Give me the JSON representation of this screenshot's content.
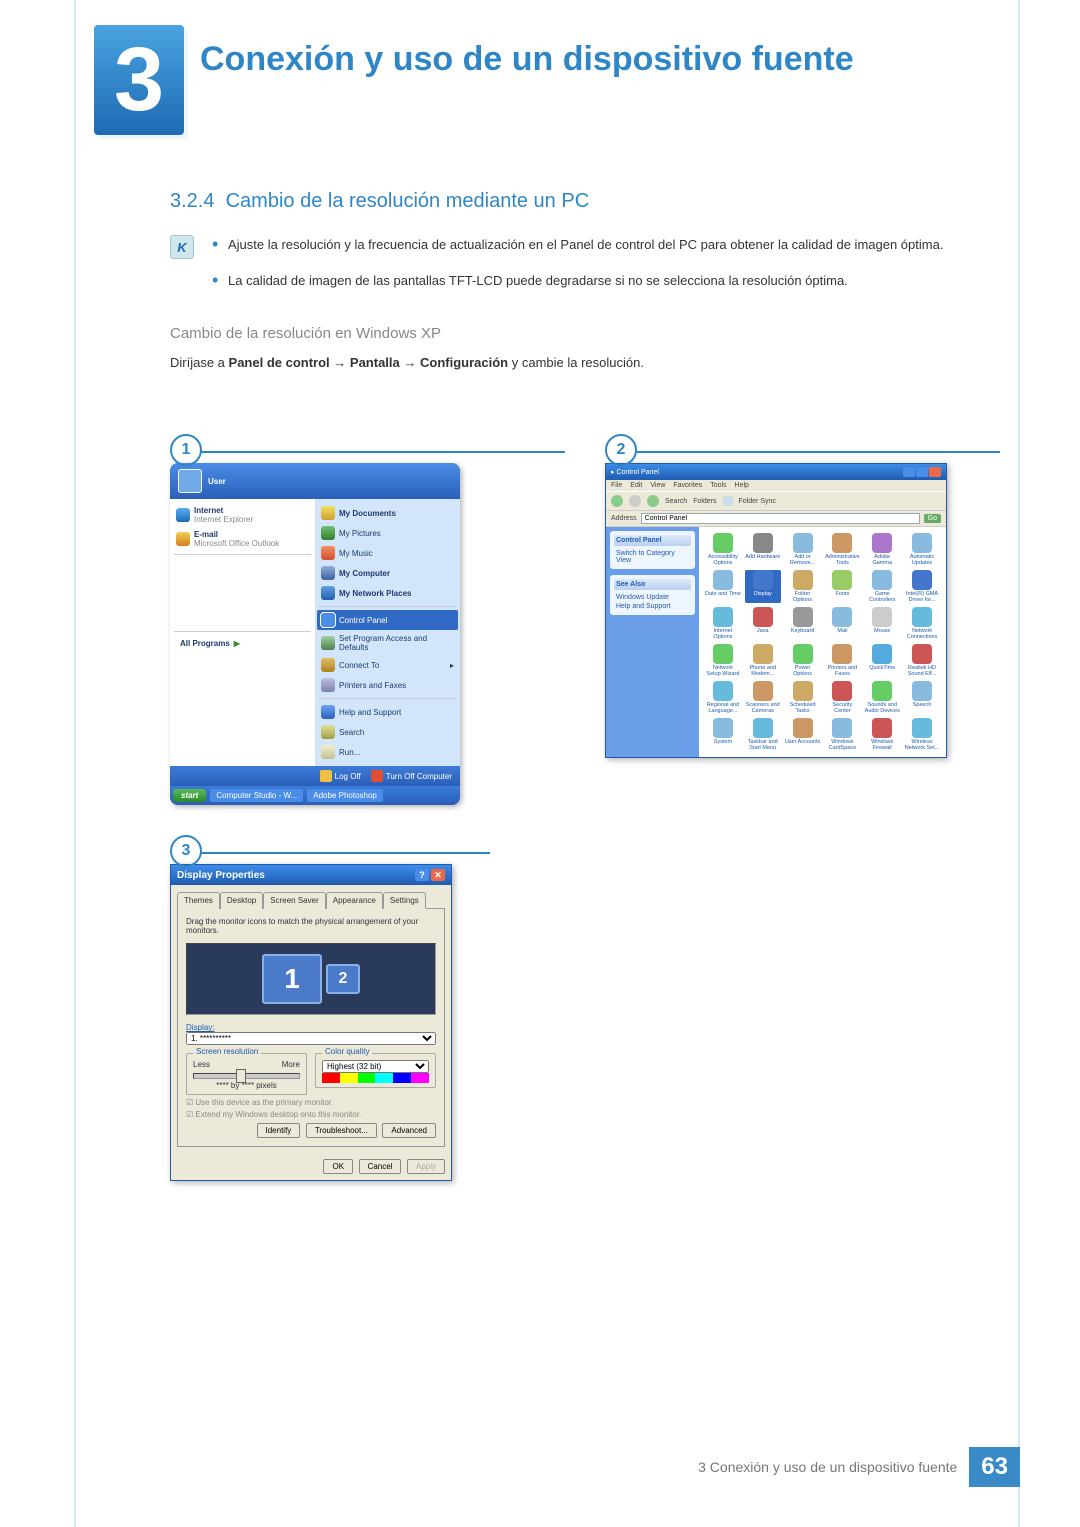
{
  "chapter": {
    "number": "3",
    "title": "Conexión y uso de un dispositivo fuente"
  },
  "section": {
    "number": "3.2.4",
    "title": "Cambio de la resolución mediante un PC"
  },
  "notes": [
    "Ajuste la resolución y la frecuencia de actualización en el Panel de control del PC para obtener la calidad de imagen óptima.",
    "La calidad de imagen de las pantallas TFT-LCD puede degradarse si no se selecciona la resolución óptima."
  ],
  "subheading": "Cambio de la resolución en Windows XP",
  "path": {
    "prefix": "Diríjase a ",
    "a": "Panel de control",
    "b": "Pantalla",
    "c": "Configuración",
    "suffix": " y cambie la resolución.",
    "arrow": " → "
  },
  "fig": {
    "n1": "1",
    "n2": "2",
    "n3": "3"
  },
  "startmenu": {
    "user": "User",
    "left": {
      "internet": "Internet",
      "internet_sub": "Internet Explorer",
      "email": "E-mail",
      "email_sub": "Microsoft Office Outlook",
      "allprograms": "All Programs"
    },
    "right": {
      "mydocs": "My Documents",
      "mypics": "My Pictures",
      "mymusic": "My Music",
      "mycomp": "My Computer",
      "mynet": "My Network Places",
      "cp": "Control Panel",
      "setprog": "Set Program Access and Defaults",
      "connect": "Connect To",
      "printers": "Printers and Faxes",
      "help": "Help and Support",
      "search": "Search",
      "run": "Run..."
    },
    "logoff": "Log Off",
    "turnoff": "Turn Off Computer",
    "taskbar": {
      "start": "start",
      "t1": "Computer Studio - W...",
      "t2": "Adobe Photoshop"
    }
  },
  "controlpanel": {
    "title": "Control Panel",
    "menus": [
      "File",
      "Edit",
      "View",
      "Favorites",
      "Tools",
      "Help"
    ],
    "toolbar": {
      "search": "Search",
      "folders": "Folders",
      "sync": "Folder Sync"
    },
    "address_label": "Address",
    "address_value": "Control Panel",
    "go": "Go",
    "side": {
      "h1": "Control Panel",
      "switch": "Switch to Category View",
      "h2": "See Also",
      "wu": "Windows Update",
      "hs": "Help and Support"
    },
    "icons": [
      "Accessibility Options",
      "Add Hardware",
      "Add or Remove...",
      "Administrative Tools",
      "Adobe Gamma",
      "Automatic Updates",
      "Date and Time",
      "Display",
      "Folder Options",
      "Fonts",
      "Game Controllers",
      "Intel(R) GMA Driver for...",
      "Internet Options",
      "Java",
      "Keyboard",
      "Mail",
      "Mouse",
      "Network Connections",
      "Network Setup Wizard",
      "Phone and Modem...",
      "Power Options",
      "Printers and Faxes",
      "QuickTime",
      "Realtek HD Sound Eff...",
      "Regional and Language...",
      "Scanners and Cameras",
      "Scheduled Tasks",
      "Security Center",
      "Sounds and Audio Devices",
      "Speech",
      "System",
      "Taskbar and Start Menu",
      "User Accounts",
      "Windows CardSpace",
      "Windows Firewall",
      "Wireless Network Set..."
    ],
    "icon_colors": [
      "#6c6",
      "#888",
      "#8bd",
      "#c96",
      "#a7c",
      "#8bd",
      "#8bd",
      "#47c",
      "#ca6",
      "#9c6",
      "#8bd",
      "#47c",
      "#6bd",
      "#c55",
      "#999",
      "#8bd",
      "#ccc",
      "#6bd",
      "#6c6",
      "#ca6",
      "#6c6",
      "#c96",
      "#5ad",
      "#c55",
      "#6bd",
      "#c96",
      "#ca6",
      "#c55",
      "#6c6",
      "#8bd",
      "#8bd",
      "#6bd",
      "#c96",
      "#8bd",
      "#c55",
      "#6bd"
    ],
    "selected_icon": 7
  },
  "display": {
    "title": "Display Properties",
    "tabs": [
      "Themes",
      "Desktop",
      "Screen Saver",
      "Appearance",
      "Settings"
    ],
    "active_tab": 4,
    "instr": "Drag the monitor icons to match the physical arrangement of your monitors.",
    "mon1": "1",
    "mon2": "2",
    "display_label": "Display:",
    "display_value": "1. **********",
    "res_legend": "Screen resolution",
    "less": "Less",
    "more": "More",
    "res_value": "**** by **** pixels",
    "cq_legend": "Color quality",
    "cq_value": "Highest (32 bit)",
    "chk1": "Use this device as the primary monitor.",
    "chk2": "Extend my Windows desktop onto this monitor.",
    "identify": "Identify",
    "trouble": "Troubleshoot...",
    "advanced": "Advanced",
    "ok": "OK",
    "cancel": "Cancel",
    "apply": "Apply"
  },
  "footer": {
    "text": "3 Conexión y uso de un dispositivo fuente",
    "page": "63"
  }
}
